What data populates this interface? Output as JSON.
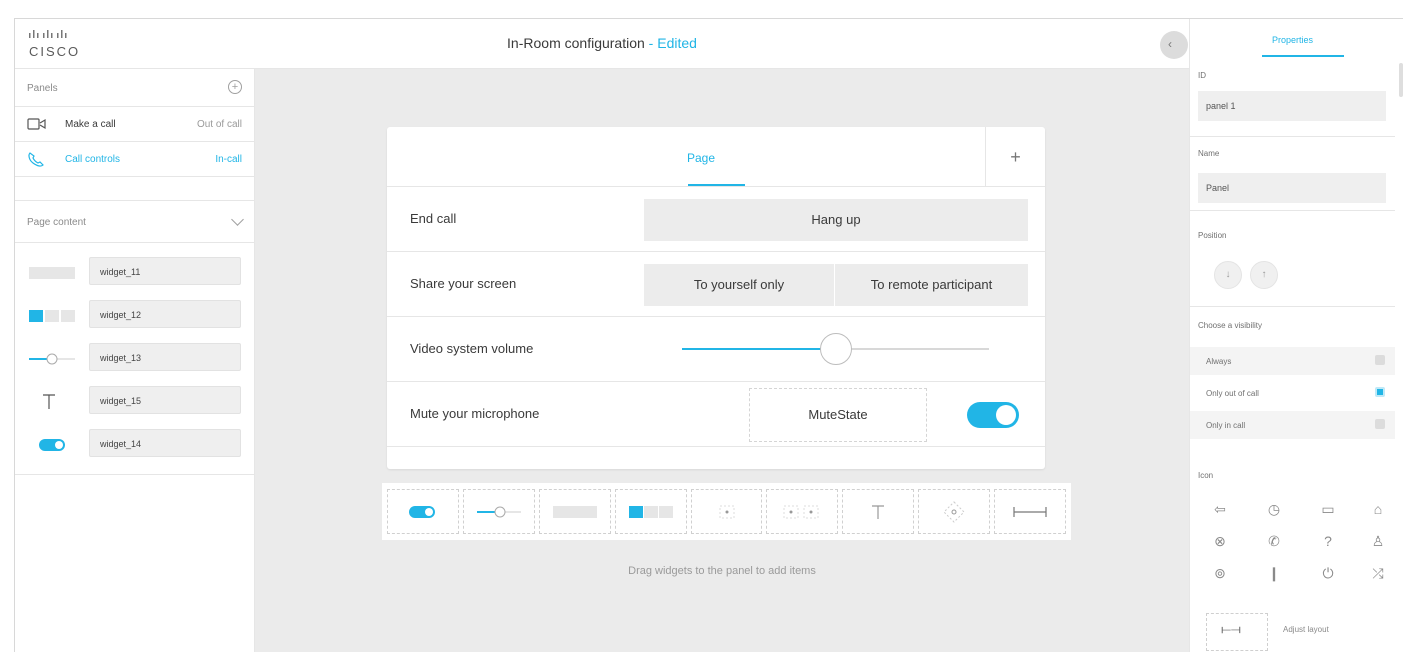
{
  "header": {
    "logo_text": "CISCO",
    "title": "In-Room configuration",
    "title_separator": " - ",
    "title_status": "Edited",
    "collapse_icon": "chevron-left-icon"
  },
  "left": {
    "panels_label": "Panels",
    "panels": [
      {
        "name": "Make a call",
        "state": "Out of call",
        "icon": "camera-icon",
        "active": false
      },
      {
        "name": "Call controls",
        "state": "In-call",
        "icon": "phone-icon",
        "active": true
      }
    ],
    "page_content_label": "Page content",
    "widgets": [
      {
        "name": "widget_11",
        "type": "button"
      },
      {
        "name": "widget_12",
        "type": "group-button"
      },
      {
        "name": "widget_13",
        "type": "slider"
      },
      {
        "name": "widget_15",
        "type": "text"
      },
      {
        "name": "widget_14",
        "type": "toggle"
      }
    ]
  },
  "canvas": {
    "tab_label": "Page",
    "add_tab_label": "+",
    "rows": [
      {
        "label": "End call",
        "button": "Hang up"
      },
      {
        "label": "Share your screen",
        "options": [
          "To yourself only",
          "To remote participant"
        ]
      },
      {
        "label": "Video system volume",
        "slider_value": 0.5
      },
      {
        "label": "Mute your microphone",
        "value_text": "MuteState",
        "toggle_on": true
      }
    ],
    "palette": [
      "toggle",
      "slider",
      "button",
      "group-button",
      "spinner",
      "double-spinner",
      "text",
      "directional-pad",
      "spacer"
    ],
    "drag_hint": "Drag widgets to the panel to add items"
  },
  "right": {
    "tab_label": "Properties",
    "id_label": "ID",
    "id_value": "panel 1",
    "name_label": "Name",
    "name_value": "Panel",
    "position_label": "Position",
    "visibility_label": "Choose a visibility",
    "visibility_options": [
      {
        "label": "Always",
        "selected": false
      },
      {
        "label": "Only out of call",
        "selected": true
      },
      {
        "label": "Only in call",
        "selected": false
      }
    ],
    "icon_label": "Icon",
    "adjust_label": "Adjust layout"
  },
  "colors": {
    "accent": "#21b5e6",
    "canvas_bg": "#ebebeb"
  }
}
